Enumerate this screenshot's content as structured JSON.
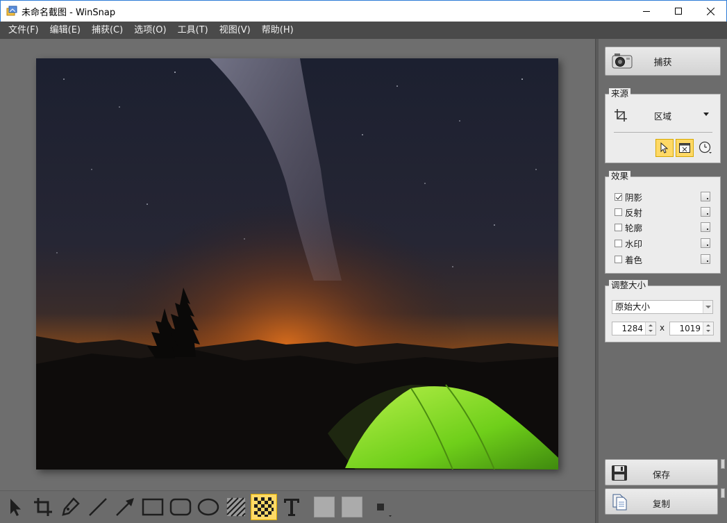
{
  "window": {
    "title": "未命名截图 - WinSnap"
  },
  "menu": [
    "文件(F)",
    "编辑(E)",
    "捕获(C)",
    "选项(O)",
    "工具(T)",
    "视图(V)",
    "帮助(H)"
  ],
  "panel": {
    "capture_label": "捕获",
    "source": {
      "group_title": "来源",
      "mode": "区域"
    },
    "effects": {
      "group_title": "效果",
      "items": [
        {
          "label": "阴影",
          "checked": true
        },
        {
          "label": "反射",
          "checked": false
        },
        {
          "label": "轮廓",
          "checked": false
        },
        {
          "label": "水印",
          "checked": false
        },
        {
          "label": "着色",
          "checked": false
        }
      ]
    },
    "resize": {
      "group_title": "调整大小",
      "mode": "原始大小",
      "width": "1284",
      "height": "1019",
      "times": "x"
    },
    "save_label": "保存",
    "copy_label": "复制"
  },
  "toolbar": {
    "tools": [
      "select-icon",
      "crop-icon",
      "pen-icon",
      "line-icon",
      "arrow-icon",
      "rectangle-icon",
      "rounded-rectangle-icon",
      "ellipse-icon",
      "hatch-icon",
      "pixelate-icon",
      "text-icon"
    ],
    "active_tool": "pixelate-icon"
  },
  "colors": {
    "accent": "#ffd966",
    "menubar": "#4a4a4a",
    "canvas": "#6e6e6e",
    "panel_group": "#ececec"
  }
}
